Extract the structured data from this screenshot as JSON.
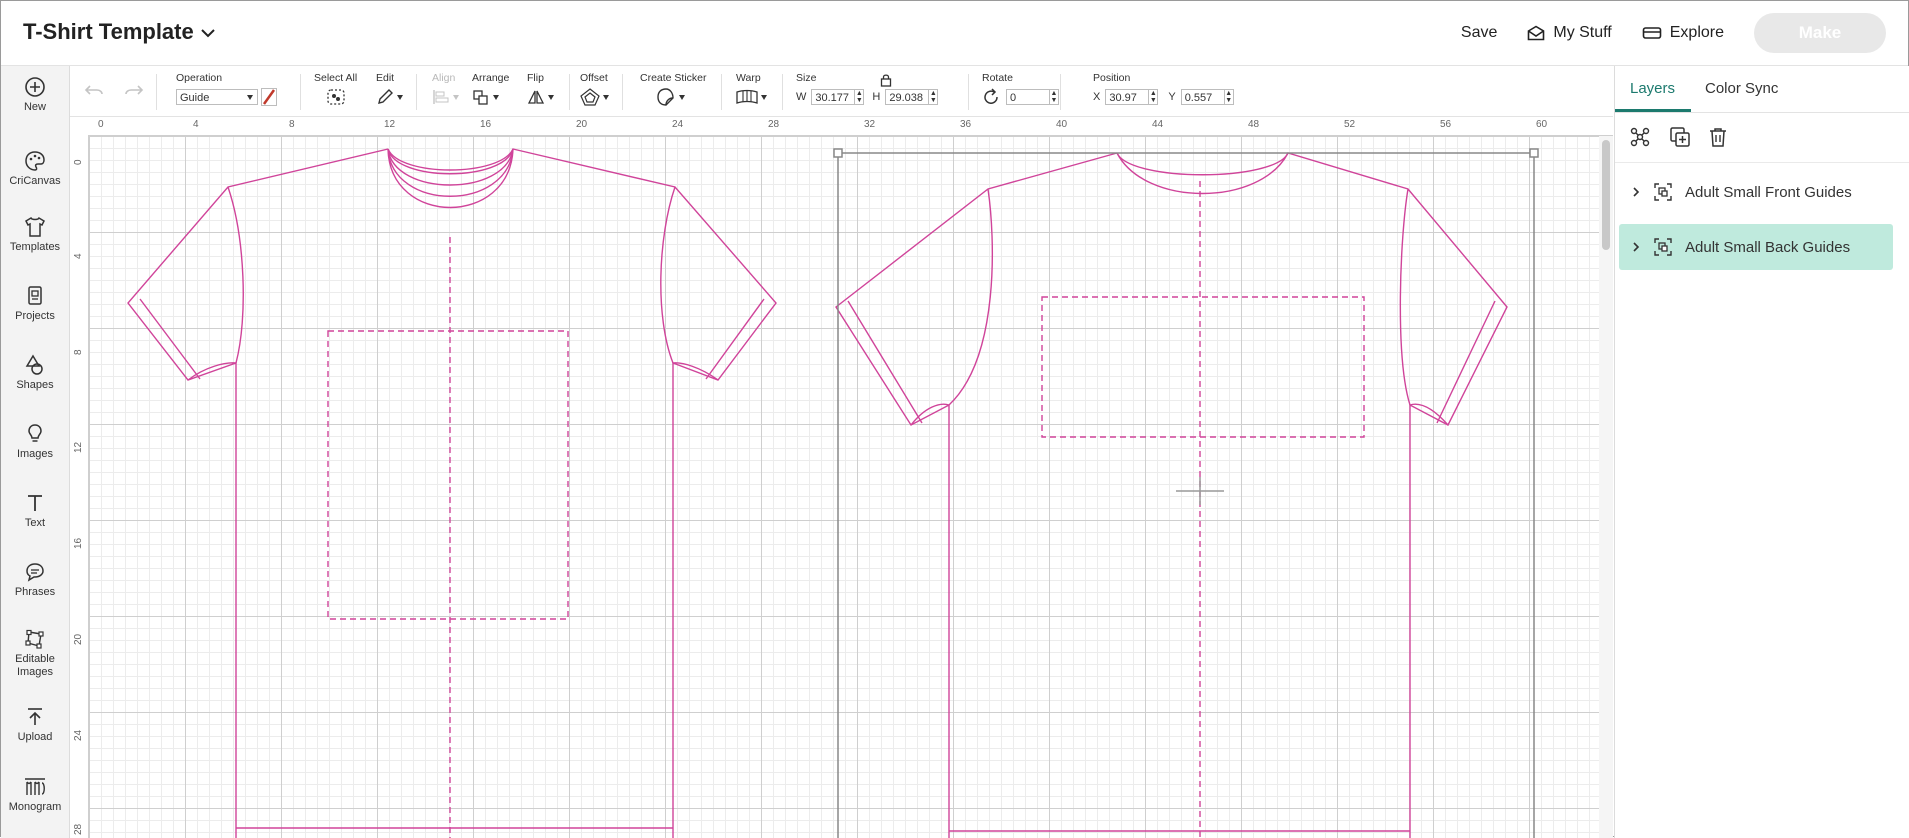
{
  "header": {
    "title": "T-Shirt Template",
    "save": "Save",
    "my_stuff": "My Stuff",
    "explore": "Explore",
    "make": "Make"
  },
  "sidebar": {
    "items": [
      {
        "label": "New",
        "icon": "plus-circle-icon"
      },
      {
        "label": "CriCanvas",
        "icon": "palette-icon"
      },
      {
        "label": "Templates",
        "icon": "shirt-icon"
      },
      {
        "label": "Projects",
        "icon": "projects-icon"
      },
      {
        "label": "Shapes",
        "icon": "shapes-icon"
      },
      {
        "label": "Images",
        "icon": "lightbulb-icon"
      },
      {
        "label": "Text",
        "icon": "text-icon"
      },
      {
        "label": "Phrases",
        "icon": "speech-bubble-icon"
      },
      {
        "label": "Editable Images",
        "icon": "editable-images-icon"
      },
      {
        "label": "Upload",
        "icon": "upload-icon"
      },
      {
        "label": "Monogram",
        "icon": "monogram-icon"
      }
    ]
  },
  "toolbar": {
    "operation_label": "Operation",
    "operation_value": "Guide",
    "select_all_label": "Select All",
    "edit_label": "Edit",
    "align_label": "Align",
    "arrange_label": "Arrange",
    "flip_label": "Flip",
    "offset_label": "Offset",
    "create_sticker_label": "Create Sticker",
    "warp_label": "Warp",
    "size_label": "Size",
    "width_prefix": "W",
    "width_value": "30.177",
    "height_prefix": "H",
    "height_value": "29.038",
    "rotate_label": "Rotate",
    "rotate_value": "0",
    "position_label": "Position",
    "x_prefix": "X",
    "x_value": "30.97",
    "y_prefix": "Y",
    "y_value": "0.557"
  },
  "canvas": {
    "ruler_top": [
      "0",
      "4",
      "8",
      "12",
      "16",
      "20",
      "24",
      "28",
      "32",
      "36",
      "40",
      "44",
      "48",
      "52",
      "56",
      "60"
    ],
    "ruler_left": [
      "0",
      "4",
      "8",
      "12",
      "16",
      "20",
      "24",
      "28"
    ]
  },
  "panel": {
    "tabs": [
      "Layers",
      "Color Sync"
    ],
    "active_tab": "Layers",
    "layers": [
      {
        "name": "Adult Small Front Guides",
        "selected": false
      },
      {
        "name": "Adult Small Back Guides",
        "selected": true
      }
    ]
  },
  "colors": {
    "guide_magenta": "#d0449a",
    "accent_teal": "#1c7a6e",
    "selected_layer": "#bfeadd"
  }
}
